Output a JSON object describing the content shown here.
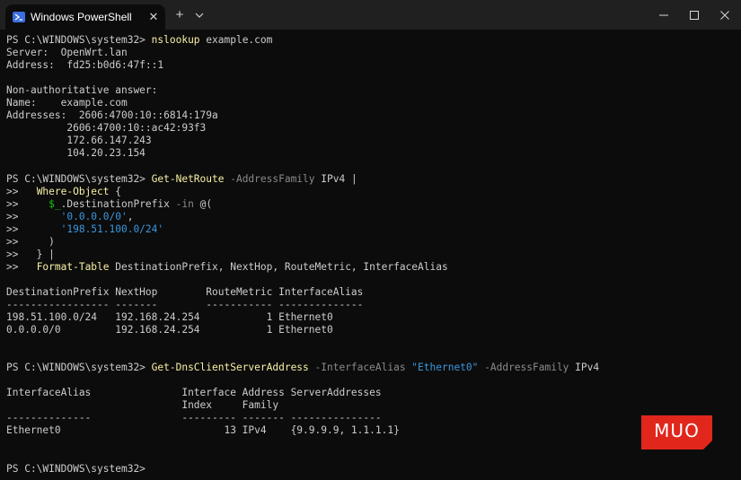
{
  "window": {
    "tab_title": "Windows PowerShell",
    "tab_close_glyph": "✕",
    "new_tab_glyph": "+",
    "icons": [
      "powershell-icon",
      "close-icon",
      "plus-icon",
      "chevron-down-icon",
      "minimize-icon",
      "maximize-icon",
      "close-window-icon"
    ]
  },
  "colors": {
    "background": "#0c0c0c",
    "titlebar": "#202020",
    "text": "#cccccc",
    "command": "#f9f1a5",
    "parameter": "#8a8a8a",
    "string": "#3a96dd",
    "variable": "#16c60c",
    "watermark": "#e1261c"
  },
  "terminal": {
    "lines": [
      [
        {
          "t": "PS C:\\WINDOWS\\system32> ",
          "c": "default"
        },
        {
          "t": "nslookup",
          "c": "cmd"
        },
        {
          "t": " example.com",
          "c": "default"
        }
      ],
      [
        {
          "t": "Server:  OpenWrt.lan",
          "c": "default"
        }
      ],
      [
        {
          "t": "Address:  fd25:b0d6:47f::1",
          "c": "default"
        }
      ],
      [],
      [
        {
          "t": "Non-authoritative answer:",
          "c": "default"
        }
      ],
      [
        {
          "t": "Name:    example.com",
          "c": "default"
        }
      ],
      [
        {
          "t": "Addresses:  2606:4700:10::6814:179a",
          "c": "default"
        }
      ],
      [
        {
          "t": "          2606:4700:10::ac42:93f3",
          "c": "default"
        }
      ],
      [
        {
          "t": "          172.66.147.243",
          "c": "default"
        }
      ],
      [
        {
          "t": "          104.20.23.154",
          "c": "default"
        }
      ],
      [],
      [
        {
          "t": "PS C:\\WINDOWS\\system32> ",
          "c": "default"
        },
        {
          "t": "Get-NetRoute",
          "c": "cmd"
        },
        {
          "t": " -AddressFamily",
          "c": "param"
        },
        {
          "t": " IPv4 |",
          "c": "default"
        }
      ],
      [
        {
          "t": ">>   ",
          "c": "default"
        },
        {
          "t": "Where-Object",
          "c": "cmd"
        },
        {
          "t": " {",
          "c": "default"
        }
      ],
      [
        {
          "t": ">>     ",
          "c": "default"
        },
        {
          "t": "$_",
          "c": "var"
        },
        {
          "t": ".DestinationPrefix",
          "c": "default"
        },
        {
          "t": " -in",
          "c": "param"
        },
        {
          "t": " @(",
          "c": "default"
        }
      ],
      [
        {
          "t": ">>       ",
          "c": "default"
        },
        {
          "t": "'0.0.0.0/0'",
          "c": "str"
        },
        {
          "t": ",",
          "c": "default"
        }
      ],
      [
        {
          "t": ">>       ",
          "c": "default"
        },
        {
          "t": "'198.51.100.0/24'",
          "c": "str"
        }
      ],
      [
        {
          "t": ">>     )",
          "c": "default"
        }
      ],
      [
        {
          "t": ">>   } |",
          "c": "default"
        }
      ],
      [
        {
          "t": ">>   ",
          "c": "default"
        },
        {
          "t": "Format-Table",
          "c": "cmd"
        },
        {
          "t": " DestinationPrefix, NextHop, RouteMetric, InterfaceAlias",
          "c": "default"
        }
      ],
      [],
      [
        {
          "t": "DestinationPrefix NextHop        RouteMetric InterfaceAlias",
          "c": "default"
        }
      ],
      [
        {
          "t": "----------------- -------        ----------- --------------",
          "c": "default"
        }
      ],
      [
        {
          "t": "198.51.100.0/24   192.168.24.254           1 Ethernet0",
          "c": "default"
        }
      ],
      [
        {
          "t": "0.0.0.0/0         192.168.24.254           1 Ethernet0",
          "c": "default"
        }
      ],
      [],
      [],
      [
        {
          "t": "PS C:\\WINDOWS\\system32> ",
          "c": "default"
        },
        {
          "t": "Get-DnsClientServerAddress",
          "c": "cmd"
        },
        {
          "t": " -InterfaceAlias",
          "c": "param"
        },
        {
          "t": " \"Ethernet0\"",
          "c": "str"
        },
        {
          "t": " -AddressFamily",
          "c": "param"
        },
        {
          "t": " IPv4",
          "c": "default"
        }
      ],
      [],
      [
        {
          "t": "InterfaceAlias               Interface Address ServerAddresses",
          "c": "default"
        }
      ],
      [
        {
          "t": "                             Index     Family",
          "c": "default"
        }
      ],
      [
        {
          "t": "--------------               --------- ------- ---------------",
          "c": "default"
        }
      ],
      [
        {
          "t": "Ethernet0                           13 IPv4    {9.9.9.9, 1.1.1.1}",
          "c": "default"
        }
      ],
      [],
      [],
      [
        {
          "t": "PS C:\\WINDOWS\\system32> ",
          "c": "default"
        }
      ]
    ]
  },
  "watermark": {
    "text": "MUO"
  }
}
